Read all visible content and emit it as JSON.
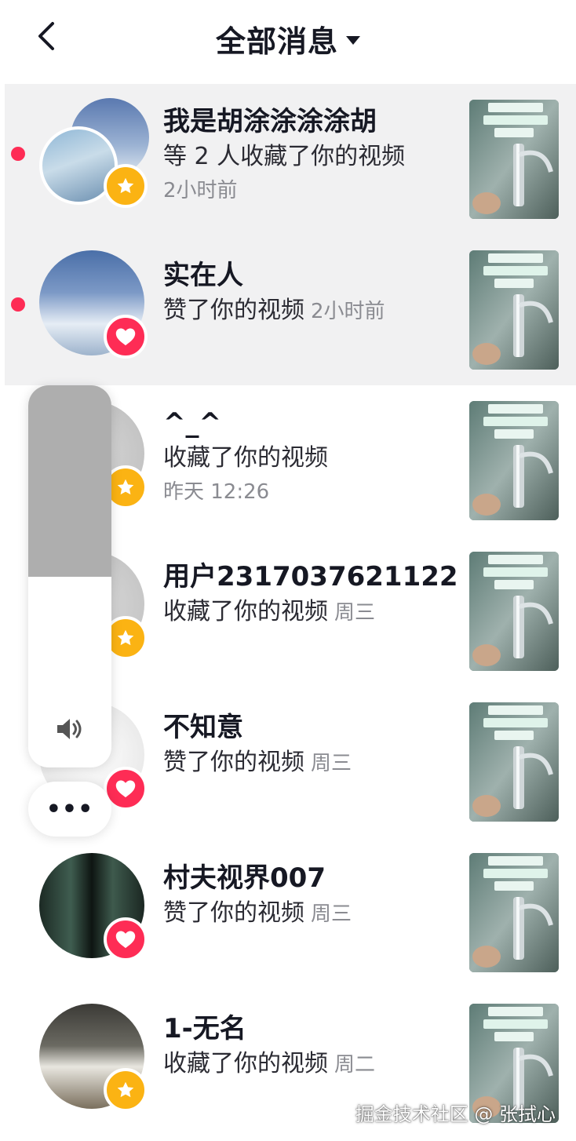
{
  "header": {
    "title": "全部消息"
  },
  "messages": [
    {
      "name": "我是胡涂涂涂涂胡",
      "action": "等 2 人收藏了你的视频",
      "time": "2小时前",
      "type": "star",
      "unread": true,
      "stacked": true,
      "time_inline": false
    },
    {
      "name": "实在人",
      "action": "赞了你的视频",
      "time": "2小时前",
      "type": "heart",
      "unread": true,
      "stacked": false,
      "time_inline": true
    },
    {
      "name": "^_^",
      "action": "收藏了你的视频",
      "time": "昨天 12:26",
      "type": "star",
      "unread": false,
      "stacked": false,
      "time_inline": false
    },
    {
      "name": "用户2317037621122",
      "action": "收藏了你的视频",
      "time": "周三",
      "type": "star",
      "unread": false,
      "stacked": false,
      "time_inline": true
    },
    {
      "name": "不知意",
      "action": "赞了你的视频",
      "time": "周三",
      "type": "heart",
      "unread": false,
      "stacked": false,
      "time_inline": true
    },
    {
      "name": "村夫视界007",
      "action": "赞了你的视频",
      "time": "周三",
      "type": "heart",
      "unread": false,
      "stacked": false,
      "time_inline": true
    },
    {
      "name": "1-无名",
      "action": "收藏了你的视频",
      "time": "周二",
      "type": "star",
      "unread": false,
      "stacked": false,
      "time_inline": true
    }
  ],
  "volume": {
    "level": 0.5,
    "icon": "speaker-icon"
  },
  "more_button": {
    "label": "•••"
  },
  "watermark": "掘金技术社区 @ 张拭心",
  "colors": {
    "accent_red": "#fe2c55",
    "star_yellow": "#fbb313",
    "unread_bg": "#f1f1f2"
  }
}
